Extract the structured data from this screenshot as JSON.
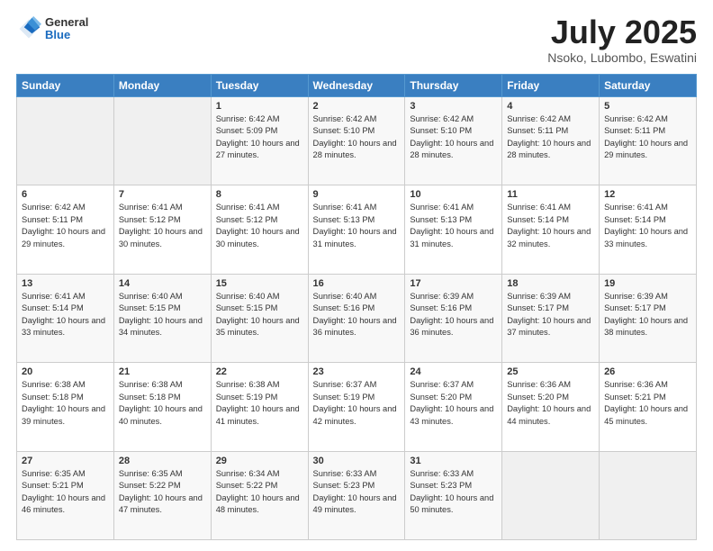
{
  "header": {
    "logo_general": "General",
    "logo_blue": "Blue",
    "title": "July 2025",
    "location": "Nsoko, Lubombo, Eswatini"
  },
  "days_of_week": [
    "Sunday",
    "Monday",
    "Tuesday",
    "Wednesday",
    "Thursday",
    "Friday",
    "Saturday"
  ],
  "weeks": [
    [
      {
        "day": "",
        "info": ""
      },
      {
        "day": "",
        "info": ""
      },
      {
        "day": "1",
        "info": "Sunrise: 6:42 AM\nSunset: 5:09 PM\nDaylight: 10 hours\nand 27 minutes."
      },
      {
        "day": "2",
        "info": "Sunrise: 6:42 AM\nSunset: 5:10 PM\nDaylight: 10 hours\nand 28 minutes."
      },
      {
        "day": "3",
        "info": "Sunrise: 6:42 AM\nSunset: 5:10 PM\nDaylight: 10 hours\nand 28 minutes."
      },
      {
        "day": "4",
        "info": "Sunrise: 6:42 AM\nSunset: 5:11 PM\nDaylight: 10 hours\nand 28 minutes."
      },
      {
        "day": "5",
        "info": "Sunrise: 6:42 AM\nSunset: 5:11 PM\nDaylight: 10 hours\nand 29 minutes."
      }
    ],
    [
      {
        "day": "6",
        "info": "Sunrise: 6:42 AM\nSunset: 5:11 PM\nDaylight: 10 hours\nand 29 minutes."
      },
      {
        "day": "7",
        "info": "Sunrise: 6:41 AM\nSunset: 5:12 PM\nDaylight: 10 hours\nand 30 minutes."
      },
      {
        "day": "8",
        "info": "Sunrise: 6:41 AM\nSunset: 5:12 PM\nDaylight: 10 hours\nand 30 minutes."
      },
      {
        "day": "9",
        "info": "Sunrise: 6:41 AM\nSunset: 5:13 PM\nDaylight: 10 hours\nand 31 minutes."
      },
      {
        "day": "10",
        "info": "Sunrise: 6:41 AM\nSunset: 5:13 PM\nDaylight: 10 hours\nand 31 minutes."
      },
      {
        "day": "11",
        "info": "Sunrise: 6:41 AM\nSunset: 5:14 PM\nDaylight: 10 hours\nand 32 minutes."
      },
      {
        "day": "12",
        "info": "Sunrise: 6:41 AM\nSunset: 5:14 PM\nDaylight: 10 hours\nand 33 minutes."
      }
    ],
    [
      {
        "day": "13",
        "info": "Sunrise: 6:41 AM\nSunset: 5:14 PM\nDaylight: 10 hours\nand 33 minutes."
      },
      {
        "day": "14",
        "info": "Sunrise: 6:40 AM\nSunset: 5:15 PM\nDaylight: 10 hours\nand 34 minutes."
      },
      {
        "day": "15",
        "info": "Sunrise: 6:40 AM\nSunset: 5:15 PM\nDaylight: 10 hours\nand 35 minutes."
      },
      {
        "day": "16",
        "info": "Sunrise: 6:40 AM\nSunset: 5:16 PM\nDaylight: 10 hours\nand 36 minutes."
      },
      {
        "day": "17",
        "info": "Sunrise: 6:39 AM\nSunset: 5:16 PM\nDaylight: 10 hours\nand 36 minutes."
      },
      {
        "day": "18",
        "info": "Sunrise: 6:39 AM\nSunset: 5:17 PM\nDaylight: 10 hours\nand 37 minutes."
      },
      {
        "day": "19",
        "info": "Sunrise: 6:39 AM\nSunset: 5:17 PM\nDaylight: 10 hours\nand 38 minutes."
      }
    ],
    [
      {
        "day": "20",
        "info": "Sunrise: 6:38 AM\nSunset: 5:18 PM\nDaylight: 10 hours\nand 39 minutes."
      },
      {
        "day": "21",
        "info": "Sunrise: 6:38 AM\nSunset: 5:18 PM\nDaylight: 10 hours\nand 40 minutes."
      },
      {
        "day": "22",
        "info": "Sunrise: 6:38 AM\nSunset: 5:19 PM\nDaylight: 10 hours\nand 41 minutes."
      },
      {
        "day": "23",
        "info": "Sunrise: 6:37 AM\nSunset: 5:19 PM\nDaylight: 10 hours\nand 42 minutes."
      },
      {
        "day": "24",
        "info": "Sunrise: 6:37 AM\nSunset: 5:20 PM\nDaylight: 10 hours\nand 43 minutes."
      },
      {
        "day": "25",
        "info": "Sunrise: 6:36 AM\nSunset: 5:20 PM\nDaylight: 10 hours\nand 44 minutes."
      },
      {
        "day": "26",
        "info": "Sunrise: 6:36 AM\nSunset: 5:21 PM\nDaylight: 10 hours\nand 45 minutes."
      }
    ],
    [
      {
        "day": "27",
        "info": "Sunrise: 6:35 AM\nSunset: 5:21 PM\nDaylight: 10 hours\nand 46 minutes."
      },
      {
        "day": "28",
        "info": "Sunrise: 6:35 AM\nSunset: 5:22 PM\nDaylight: 10 hours\nand 47 minutes."
      },
      {
        "day": "29",
        "info": "Sunrise: 6:34 AM\nSunset: 5:22 PM\nDaylight: 10 hours\nand 48 minutes."
      },
      {
        "day": "30",
        "info": "Sunrise: 6:33 AM\nSunset: 5:23 PM\nDaylight: 10 hours\nand 49 minutes."
      },
      {
        "day": "31",
        "info": "Sunrise: 6:33 AM\nSunset: 5:23 PM\nDaylight: 10 hours\nand 50 minutes."
      },
      {
        "day": "",
        "info": ""
      },
      {
        "day": "",
        "info": ""
      }
    ]
  ]
}
